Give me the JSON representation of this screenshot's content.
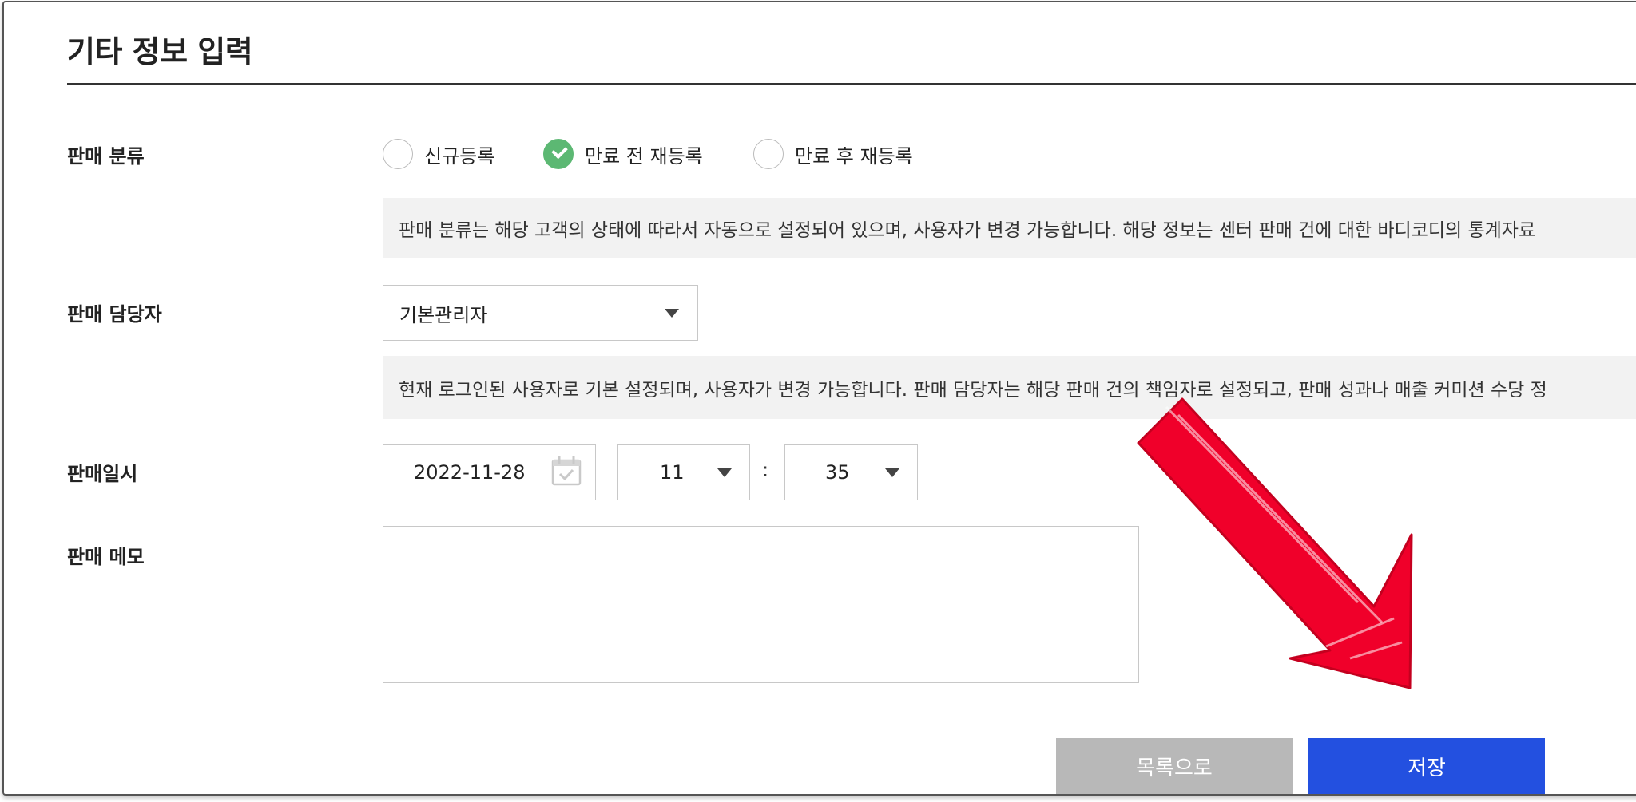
{
  "section": {
    "title": "기타 정보 입력"
  },
  "sale_type": {
    "label": "판매 분류",
    "options": [
      {
        "label": "신규등록",
        "checked": false
      },
      {
        "label": "만료 전 재등록",
        "checked": true
      },
      {
        "label": "만료 후 재등록",
        "checked": false
      }
    ],
    "help": "판매 분류는 해당 고객의 상태에 따라서 자동으로 설정되어 있으며, 사용자가 변경 가능합니다. 해당 정보는 센터 판매 건에 대한 바디코디의 통계자료"
  },
  "sales_rep": {
    "label": "판매 담당자",
    "selected": "기본관리자",
    "help": "현재 로그인된 사용자로 기본 설정되며, 사용자가 변경 가능합니다. 판매 담당자는 해당 판매 건의 책임자로 설정되고, 판매 성과나 매출 커미션 수당 정"
  },
  "sale_datetime": {
    "label": "판매일시",
    "date": "2022-11-28",
    "hour": "11",
    "separator": ":",
    "minute": "35"
  },
  "memo": {
    "label": "판매 메모",
    "value": ""
  },
  "buttons": {
    "list": "목록으로",
    "save": "저장"
  },
  "colors": {
    "primary_button": "#2350e0",
    "secondary_button": "#b8b8b8",
    "radio_checked": "#5cb873",
    "annotation_arrow": "#f0002a"
  },
  "icons": [
    "check-icon",
    "chevron-down-icon",
    "calendar-icon",
    "arrow-annotation"
  ]
}
